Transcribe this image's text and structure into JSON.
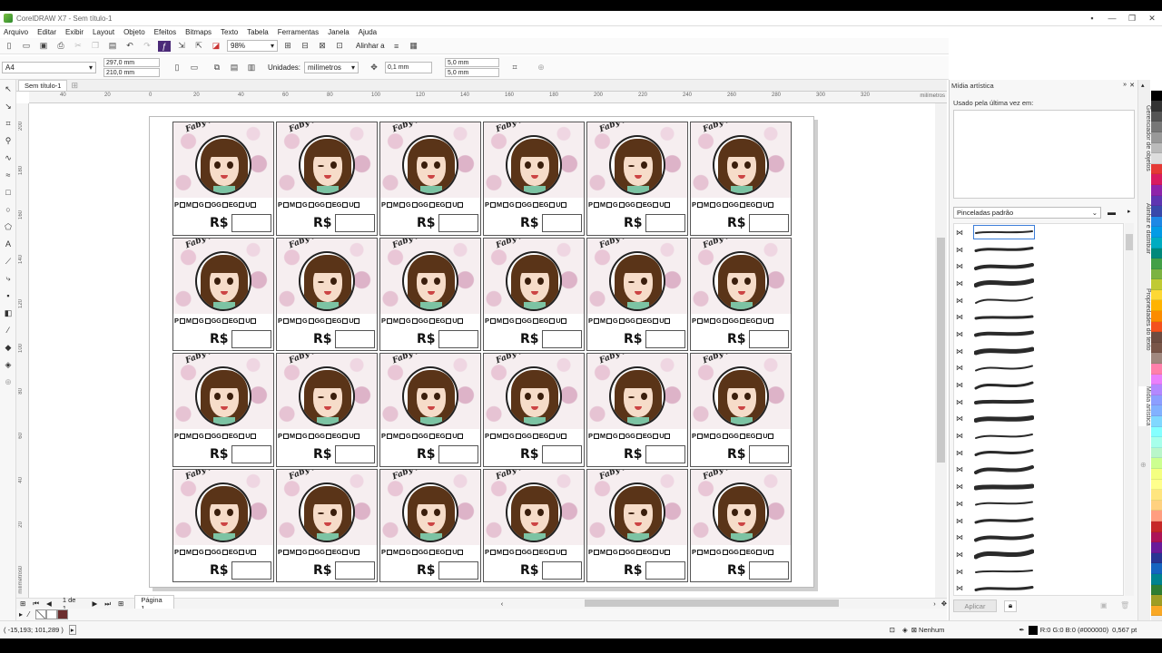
{
  "window": {
    "title": "CorelDRAW X7 - Sem título-1"
  },
  "menu": [
    "Arquivo",
    "Editar",
    "Exibir",
    "Layout",
    "Objeto",
    "Efeitos",
    "Bitmaps",
    "Texto",
    "Tabela",
    "Ferramentas",
    "Janela",
    "Ajuda"
  ],
  "toolbar": {
    "zoom": "98%",
    "align_label": "Alinhar a"
  },
  "propbar": {
    "page_size": "A4",
    "width": "297,0 mm",
    "height": "210,0 mm",
    "units_label": "Unidades:",
    "units": "milímetros",
    "nudge": "0,1 mm",
    "dup_x": "5,0 mm",
    "dup_y": "5,0 mm"
  },
  "document": {
    "tab": "Sem título-1",
    "ruler_h_ticks": [
      "40",
      "20",
      "0",
      "20",
      "40",
      "60",
      "80",
      "100",
      "120",
      "140",
      "160",
      "180",
      "200",
      "220",
      "240",
      "260",
      "280",
      "300",
      "320"
    ],
    "ruler_unit": "milímetros",
    "ruler_v_ticks": [
      "200",
      "180",
      "160",
      "140",
      "120",
      "100",
      "80",
      "60",
      "40",
      "20",
      "0"
    ],
    "ruler_v_unit": "milímetros"
  },
  "label": {
    "brand": "Faby Películas e Modinhas",
    "sizes": [
      "P",
      "M",
      "G",
      "GG",
      "EG",
      "U"
    ],
    "price": "R$",
    "count": 24
  },
  "pager": {
    "of": "1 de 1",
    "page_tab": "Página 1"
  },
  "status": {
    "coords": "( -15,193; 101,289 )",
    "fill": "Nenhum",
    "color": "R:0 G:0 B:0 (#000000)",
    "width": "0,567 pt"
  },
  "docker": {
    "title": "Mídia artística",
    "recent_label": "Usado pela última vez em:",
    "category": "Pinceladas padrão",
    "apply": "Aplicar",
    "stroke_count": 22
  },
  "vertical_tabs": [
    "Gerenciador de objetos",
    "Alinhar e distribuir",
    "Propriedades do texto",
    "Mídia artística"
  ],
  "palette": [
    "#ffffff",
    "#000000",
    "#333333",
    "#555555",
    "#777777",
    "#999999",
    "#bbbbbb",
    "#dddddd",
    "#e53935",
    "#d81b60",
    "#8e24aa",
    "#5e35b1",
    "#3949ab",
    "#1e88e5",
    "#039be5",
    "#00acc1",
    "#00897b",
    "#43a047",
    "#7cb342",
    "#c0ca33",
    "#fdd835",
    "#ffb300",
    "#fb8c00",
    "#f4511e",
    "#6d4c41",
    "#795548",
    "#a1887f",
    "#ff80ab",
    "#ea80fc",
    "#b388ff",
    "#8c9eff",
    "#82b1ff",
    "#80d8ff",
    "#84ffff",
    "#a7ffeb",
    "#b9f6ca",
    "#ccff90",
    "#f4ff81",
    "#ffff8d",
    "#ffe57f",
    "#ffd180",
    "#ff9e80",
    "#c62828",
    "#ad1457",
    "#6a1b9a",
    "#283593",
    "#1565c0",
    "#00838f",
    "#2e7d32",
    "#9e9d24",
    "#f9a825"
  ]
}
